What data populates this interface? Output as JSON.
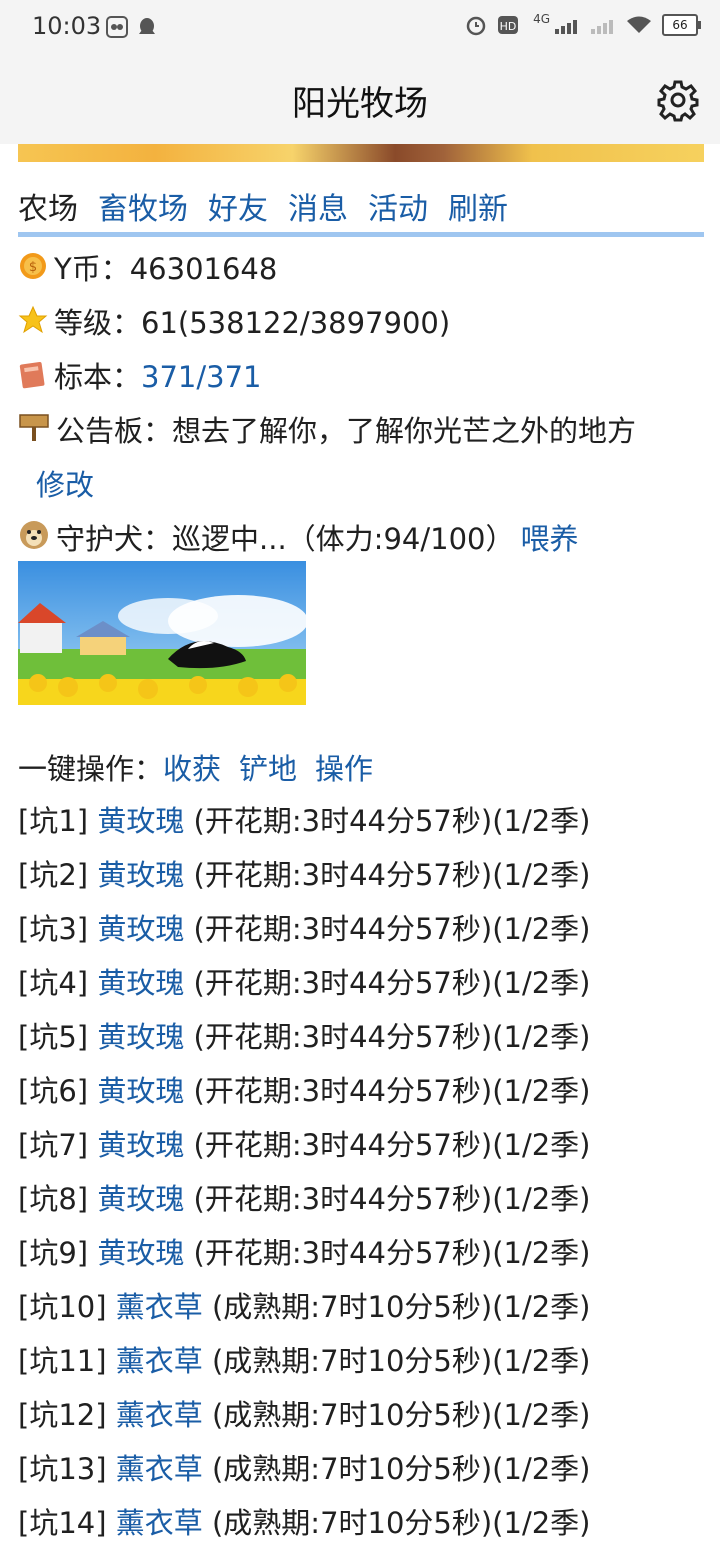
{
  "status_bar": {
    "time": "10:03",
    "network": "4G",
    "battery": "66",
    "left_icons": [
      "gallery-icon",
      "qq-icon"
    ],
    "right_icons": [
      "alarm-icon",
      "hd-icon",
      "signal-icon",
      "wifi-icon",
      "battery-icon"
    ]
  },
  "app": {
    "title": "阳光牧场"
  },
  "nav": {
    "current": "农场",
    "links": [
      "畜牧场",
      "好友",
      "消息",
      "活动",
      "刷新"
    ]
  },
  "info": {
    "coins_label": "Y币：",
    "coins_value": "46301648",
    "level_label": "等级：",
    "level_value": "61(538122/3897900)",
    "specimen_label": "标本：",
    "specimen_value": "371/371",
    "board_label": "公告板：",
    "board_value": "想去了解你，了解你光芒之外的地方",
    "board_edit": "修改",
    "dog_label": "守护犬：",
    "dog_status": "巡逻中...（体力:94/100）",
    "dog_feed": "喂养"
  },
  "one_key": {
    "label": "一键操作：",
    "actions": [
      "收获",
      "铲地",
      "操作"
    ]
  },
  "plots": [
    {
      "id": "[坑1]",
      "crop": "黄玫瑰",
      "status": "(开花期:3时44分57秒)(1/2季)"
    },
    {
      "id": "[坑2]",
      "crop": "黄玫瑰",
      "status": "(开花期:3时44分57秒)(1/2季)"
    },
    {
      "id": "[坑3]",
      "crop": "黄玫瑰",
      "status": "(开花期:3时44分57秒)(1/2季)"
    },
    {
      "id": "[坑4]",
      "crop": "黄玫瑰",
      "status": "(开花期:3时44分57秒)(1/2季)"
    },
    {
      "id": "[坑5]",
      "crop": "黄玫瑰",
      "status": "(开花期:3时44分57秒)(1/2季)"
    },
    {
      "id": "[坑6]",
      "crop": "黄玫瑰",
      "status": "(开花期:3时44分57秒)(1/2季)"
    },
    {
      "id": "[坑7]",
      "crop": "黄玫瑰",
      "status": "(开花期:3时44分57秒)(1/2季)"
    },
    {
      "id": "[坑8]",
      "crop": "黄玫瑰",
      "status": "(开花期:3时44分57秒)(1/2季)"
    },
    {
      "id": "[坑9]",
      "crop": "黄玫瑰",
      "status": "(开花期:3时44分57秒)(1/2季)"
    },
    {
      "id": "[坑10]",
      "crop": "薰衣草",
      "status": "(成熟期:7时10分5秒)(1/2季)"
    },
    {
      "id": "[坑11]",
      "crop": "薰衣草",
      "status": "(成熟期:7时10分5秒)(1/2季)"
    },
    {
      "id": "[坑12]",
      "crop": "薰衣草",
      "status": "(成熟期:7时10分5秒)(1/2季)"
    },
    {
      "id": "[坑13]",
      "crop": "薰衣草",
      "status": "(成熟期:7时10分5秒)(1/2季)"
    },
    {
      "id": "[坑14]",
      "crop": "薰衣草",
      "status": "(成熟期:7时10分5秒)(1/2季)"
    }
  ],
  "colors": {
    "link": "#1a5da6",
    "nav_underline": "#9fc6f0",
    "bar_bg": "#f4f4f4"
  }
}
